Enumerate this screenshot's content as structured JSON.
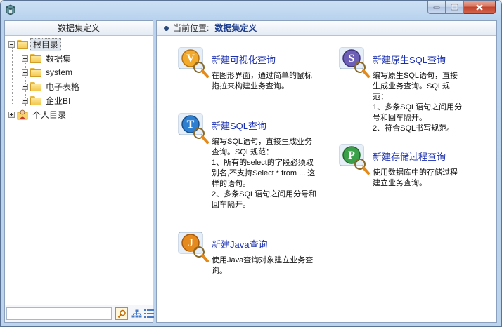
{
  "window": {
    "controls": [
      "minimize",
      "maximize",
      "close"
    ]
  },
  "left_panel": {
    "title": "数据集定义",
    "tree": {
      "root": "根目录",
      "children": [
        "数据集",
        "system",
        "电子表格",
        "企业BI"
      ],
      "personal": "个人目录"
    },
    "filter": {
      "value": "",
      "placeholder": ""
    }
  },
  "breadcrumb": {
    "prefix": "当前位置:",
    "current": "数据集定义"
  },
  "cards": {
    "visual": {
      "title": "新建可视化查询",
      "desc": "    在图形界面，通过简单的鼠标拖拉来构建业务查询。",
      "letter": "V",
      "color": "#f3a92a"
    },
    "sql": {
      "title": "新建SQL查询",
      "desc": "    编写SQL语句，直接生成业务查询。SQL规范：\n    1、所有的select的字段必须取别名,不支持Select * from ... 这样的语句。\n    2、多条SQL语句之间用分号和回车隔开。",
      "letter": "T",
      "color": "#2f7fd0"
    },
    "java": {
      "title": "新建Java查询",
      "desc": "    使用Java查询对象建立业务查询。",
      "letter": "J",
      "color": "#e58a1e"
    },
    "native": {
      "title": "新建原生SQL查询",
      "desc": "    编写原生SQL语句，直接生成业务查询。SQL规范：\n    1、多条SQL语句之间用分号和回车隔开。\n    2、符合SQL书写规范。",
      "letter": "S",
      "color": "#6c5fb5"
    },
    "procedure": {
      "title": "新建存储过程查询",
      "desc": "    使用数据库中的存储过程建立业务查询。",
      "letter": "P",
      "color": "#3aa14a"
    }
  }
}
